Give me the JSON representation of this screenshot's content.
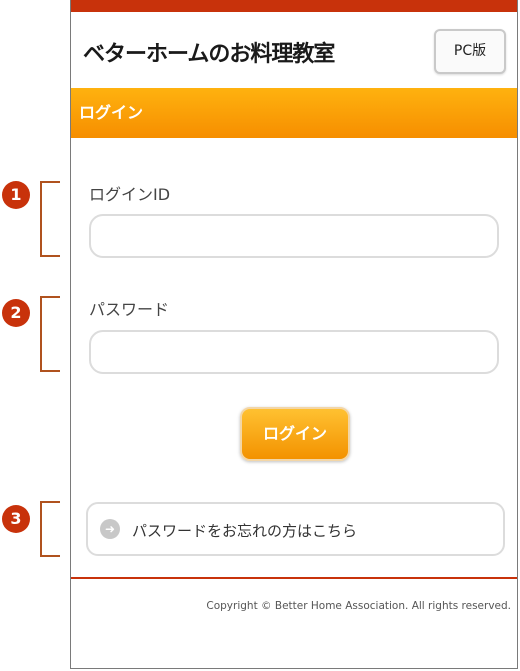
{
  "header": {
    "logo_text": "ベターホームのお料理教室",
    "pc_button": "PC版"
  },
  "page_title": "ログイン",
  "login_id": {
    "label": "ログインID",
    "value": ""
  },
  "password": {
    "label": "パスワード",
    "value": ""
  },
  "login_button": "ログイン",
  "forgot_link": {
    "label": "パスワードをお忘れの方はこちら",
    "icon": "arrow-right-circle-icon"
  },
  "footer": {
    "copyright": "Copyright © Better Home Association. All rights reserved."
  },
  "callouts": [
    "1",
    "2",
    "3"
  ],
  "colors": {
    "accent": "#c8320b",
    "orange": "#f68e00"
  }
}
